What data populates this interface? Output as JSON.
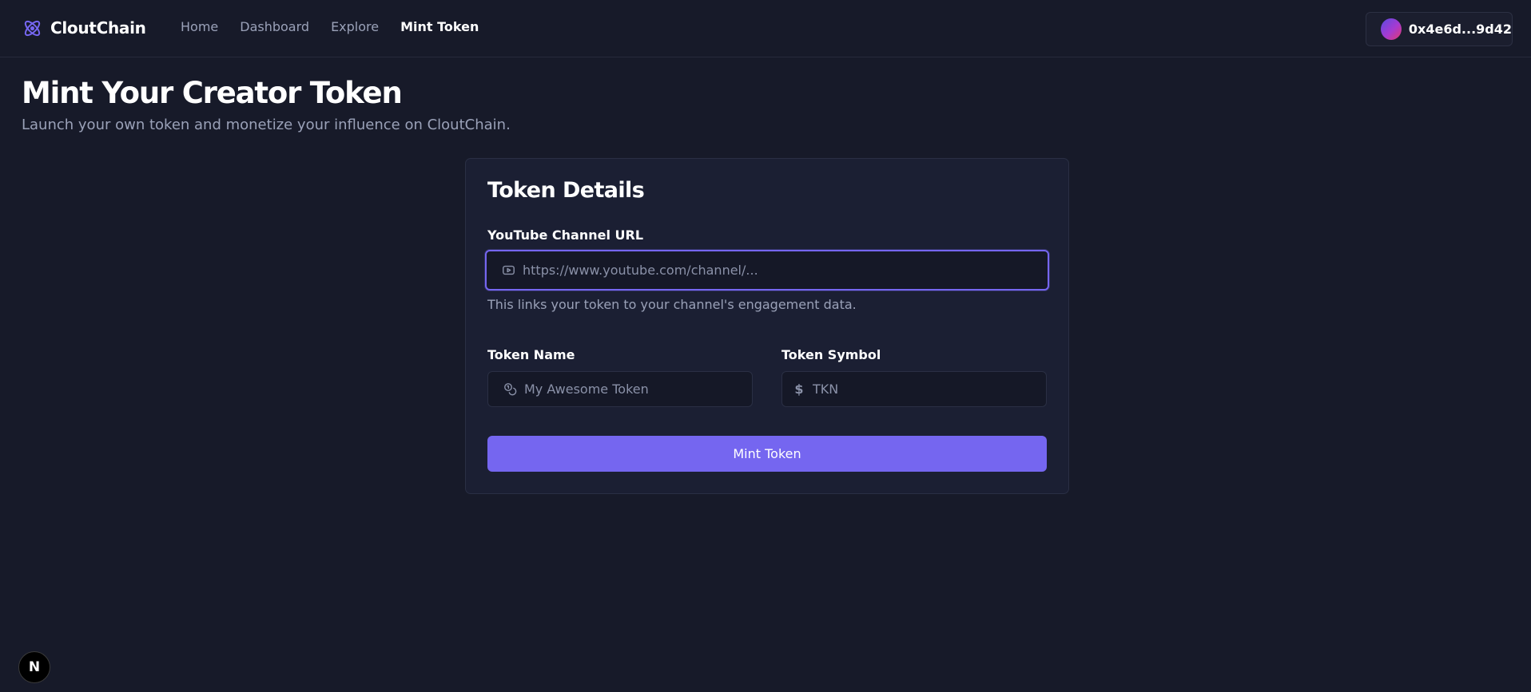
{
  "app": {
    "brand_name": "CloutChain",
    "brand_icon": "atom-icon",
    "accent_color": "#7566f0",
    "background_color": "#171a29"
  },
  "nav": {
    "links": [
      {
        "label": "Home",
        "active": false
      },
      {
        "label": "Dashboard",
        "active": false
      },
      {
        "label": "Explore",
        "active": false
      },
      {
        "label": "Mint Token",
        "active": true
      }
    ]
  },
  "wallet": {
    "address": "0x4e6d...9d42",
    "avatar": "gradient-avatar"
  },
  "page": {
    "title": "Mint Your Creator Token",
    "subtitle": "Launch your own token and monetize your influence on CloutChain."
  },
  "form": {
    "card_title": "Token Details",
    "youtube": {
      "label": "YouTube Channel URL",
      "placeholder": "https://www.youtube.com/channel/...",
      "value": "",
      "icon": "youtube-icon",
      "helper": "This links your token to your channel's engagement data."
    },
    "token_name": {
      "label": "Token Name",
      "placeholder": "My Awesome Token",
      "value": "",
      "icon": "coins-icon"
    },
    "token_symbol": {
      "label": "Token Symbol",
      "placeholder": "TKN",
      "value": "",
      "icon": "dollar-icon",
      "icon_glyph": "$"
    },
    "submit_label": "Mint Token"
  },
  "dev_badge": {
    "label": "N"
  }
}
